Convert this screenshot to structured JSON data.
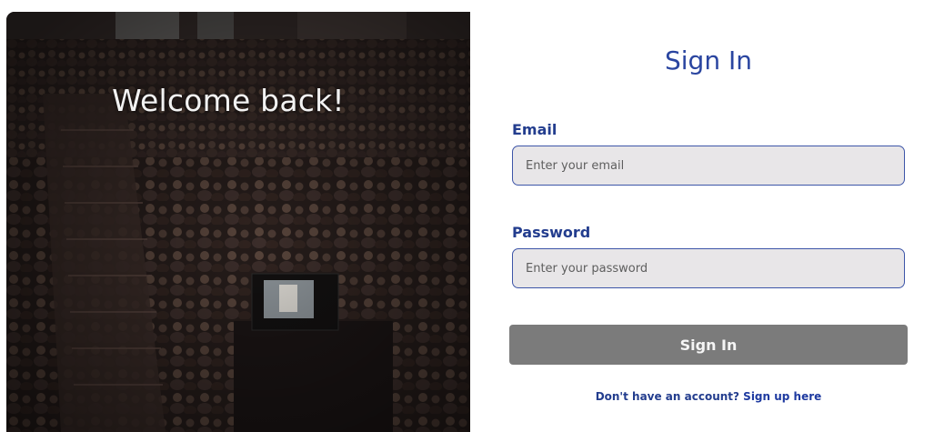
{
  "hero": {
    "heading": "Welcome back!",
    "image": "lecture-hall-audience-photo"
  },
  "form": {
    "title": "Sign In",
    "email": {
      "label": "Email",
      "placeholder": "Enter your email",
      "value": ""
    },
    "password": {
      "label": "Password",
      "placeholder": "Enter your password",
      "value": ""
    },
    "submit_label": "Sign In",
    "signup_prompt": "Don't have an account?",
    "signup_link": "Sign up here"
  },
  "colors": {
    "accent": "#2a45a0",
    "label": "#233d8e",
    "input_bg": "#e8e6e8",
    "input_border": "#3d55a8",
    "button_bg": "#7b7b7b"
  }
}
